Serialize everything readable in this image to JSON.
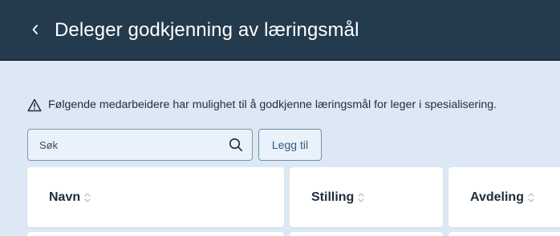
{
  "header": {
    "title": "Deleger godkjenning av læringsmål",
    "back_icon": "chevron-left-icon"
  },
  "info": {
    "icon": "warning-triangle-icon",
    "text": "Følgende medarbeidere har mulighet til å godkjenne læringsmål for leger i spesialisering."
  },
  "search": {
    "placeholder": "Søk",
    "value": "",
    "icon": "search-icon"
  },
  "add_button": {
    "label": "Legg til"
  },
  "table": {
    "columns": [
      {
        "label": "Navn",
        "sort_icon": "sort-icon"
      },
      {
        "label": "Stilling",
        "sort_icon": "sort-icon"
      },
      {
        "label": "Avdeling",
        "sort_icon": "sort-icon"
      }
    ]
  },
  "colors": {
    "header_bg": "#243a4d",
    "page_bg": "#dce8f3",
    "card_bg": "#ffffff",
    "button_border": "#6f8fad"
  }
}
